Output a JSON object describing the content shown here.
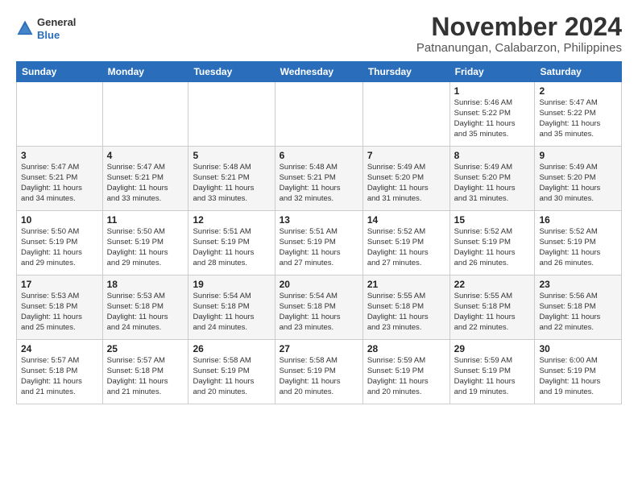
{
  "header": {
    "logo_general": "General",
    "logo_blue": "Blue",
    "title": "November 2024",
    "subtitle": "Patnanungan, Calabarzon, Philippines"
  },
  "weekdays": [
    "Sunday",
    "Monday",
    "Tuesday",
    "Wednesday",
    "Thursday",
    "Friday",
    "Saturday"
  ],
  "weeks": [
    [
      {
        "date": "",
        "info": ""
      },
      {
        "date": "",
        "info": ""
      },
      {
        "date": "",
        "info": ""
      },
      {
        "date": "",
        "info": ""
      },
      {
        "date": "",
        "info": ""
      },
      {
        "date": "1",
        "info": "Sunrise: 5:46 AM\nSunset: 5:22 PM\nDaylight: 11 hours\nand 35 minutes."
      },
      {
        "date": "2",
        "info": "Sunrise: 5:47 AM\nSunset: 5:22 PM\nDaylight: 11 hours\nand 35 minutes."
      }
    ],
    [
      {
        "date": "3",
        "info": "Sunrise: 5:47 AM\nSunset: 5:21 PM\nDaylight: 11 hours\nand 34 minutes."
      },
      {
        "date": "4",
        "info": "Sunrise: 5:47 AM\nSunset: 5:21 PM\nDaylight: 11 hours\nand 33 minutes."
      },
      {
        "date": "5",
        "info": "Sunrise: 5:48 AM\nSunset: 5:21 PM\nDaylight: 11 hours\nand 33 minutes."
      },
      {
        "date": "6",
        "info": "Sunrise: 5:48 AM\nSunset: 5:21 PM\nDaylight: 11 hours\nand 32 minutes."
      },
      {
        "date": "7",
        "info": "Sunrise: 5:49 AM\nSunset: 5:20 PM\nDaylight: 11 hours\nand 31 minutes."
      },
      {
        "date": "8",
        "info": "Sunrise: 5:49 AM\nSunset: 5:20 PM\nDaylight: 11 hours\nand 31 minutes."
      },
      {
        "date": "9",
        "info": "Sunrise: 5:49 AM\nSunset: 5:20 PM\nDaylight: 11 hours\nand 30 minutes."
      }
    ],
    [
      {
        "date": "10",
        "info": "Sunrise: 5:50 AM\nSunset: 5:19 PM\nDaylight: 11 hours\nand 29 minutes."
      },
      {
        "date": "11",
        "info": "Sunrise: 5:50 AM\nSunset: 5:19 PM\nDaylight: 11 hours\nand 29 minutes."
      },
      {
        "date": "12",
        "info": "Sunrise: 5:51 AM\nSunset: 5:19 PM\nDaylight: 11 hours\nand 28 minutes."
      },
      {
        "date": "13",
        "info": "Sunrise: 5:51 AM\nSunset: 5:19 PM\nDaylight: 11 hours\nand 27 minutes."
      },
      {
        "date": "14",
        "info": "Sunrise: 5:52 AM\nSunset: 5:19 PM\nDaylight: 11 hours\nand 27 minutes."
      },
      {
        "date": "15",
        "info": "Sunrise: 5:52 AM\nSunset: 5:19 PM\nDaylight: 11 hours\nand 26 minutes."
      },
      {
        "date": "16",
        "info": "Sunrise: 5:52 AM\nSunset: 5:19 PM\nDaylight: 11 hours\nand 26 minutes."
      }
    ],
    [
      {
        "date": "17",
        "info": "Sunrise: 5:53 AM\nSunset: 5:18 PM\nDaylight: 11 hours\nand 25 minutes."
      },
      {
        "date": "18",
        "info": "Sunrise: 5:53 AM\nSunset: 5:18 PM\nDaylight: 11 hours\nand 24 minutes."
      },
      {
        "date": "19",
        "info": "Sunrise: 5:54 AM\nSunset: 5:18 PM\nDaylight: 11 hours\nand 24 minutes."
      },
      {
        "date": "20",
        "info": "Sunrise: 5:54 AM\nSunset: 5:18 PM\nDaylight: 11 hours\nand 23 minutes."
      },
      {
        "date": "21",
        "info": "Sunrise: 5:55 AM\nSunset: 5:18 PM\nDaylight: 11 hours\nand 23 minutes."
      },
      {
        "date": "22",
        "info": "Sunrise: 5:55 AM\nSunset: 5:18 PM\nDaylight: 11 hours\nand 22 minutes."
      },
      {
        "date": "23",
        "info": "Sunrise: 5:56 AM\nSunset: 5:18 PM\nDaylight: 11 hours\nand 22 minutes."
      }
    ],
    [
      {
        "date": "24",
        "info": "Sunrise: 5:57 AM\nSunset: 5:18 PM\nDaylight: 11 hours\nand 21 minutes."
      },
      {
        "date": "25",
        "info": "Sunrise: 5:57 AM\nSunset: 5:18 PM\nDaylight: 11 hours\nand 21 minutes."
      },
      {
        "date": "26",
        "info": "Sunrise: 5:58 AM\nSunset: 5:19 PM\nDaylight: 11 hours\nand 20 minutes."
      },
      {
        "date": "27",
        "info": "Sunrise: 5:58 AM\nSunset: 5:19 PM\nDaylight: 11 hours\nand 20 minutes."
      },
      {
        "date": "28",
        "info": "Sunrise: 5:59 AM\nSunset: 5:19 PM\nDaylight: 11 hours\nand 20 minutes."
      },
      {
        "date": "29",
        "info": "Sunrise: 5:59 AM\nSunset: 5:19 PM\nDaylight: 11 hours\nand 19 minutes."
      },
      {
        "date": "30",
        "info": "Sunrise: 6:00 AM\nSunset: 5:19 PM\nDaylight: 11 hours\nand 19 minutes."
      }
    ]
  ]
}
